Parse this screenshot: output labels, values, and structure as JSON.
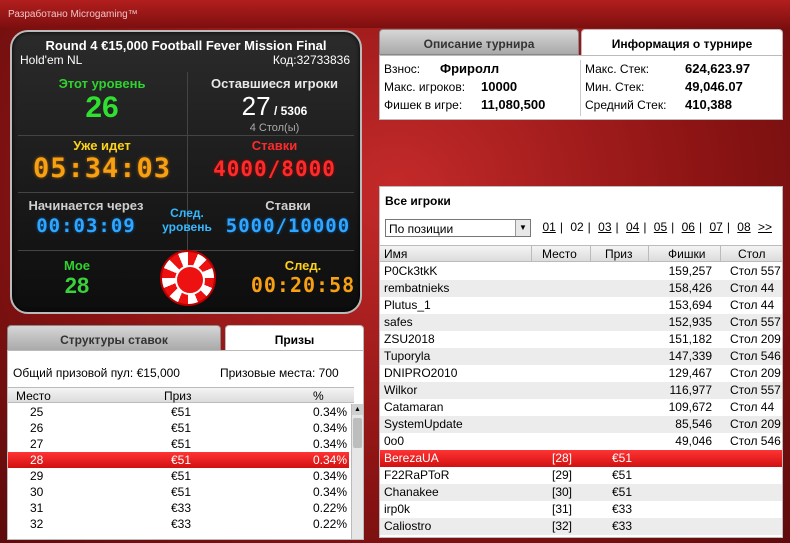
{
  "topbar": {
    "credit": "Разработано Microgaming™"
  },
  "clock": {
    "title": "Round 4 €15,000 Football Fever Mission Final",
    "game": "Hold'em NL",
    "code": "Код:32733836",
    "current_level_label": "Этот уровень",
    "current_level": "26",
    "players_left_label": "Оставшиеся игроки",
    "players_left": "27",
    "players_total": "/ 5306",
    "tables": "4 Стол(ы)",
    "elapsed_label": "Уже идет",
    "elapsed": "05:34:03",
    "stakes_label": "Ставки",
    "stakes": "4000/8000",
    "starts_in_label": "Начинается через",
    "starts_in": "00:03:09",
    "next_level_label_1": "След.",
    "next_level_label_2": "уровень",
    "next_stakes_label": "Ставки",
    "next_stakes": "5000/10000",
    "my_label": "Мое",
    "my_value": "28",
    "next_label": "След.",
    "next_time": "00:20:58"
  },
  "tabs_top": {
    "description": "Описание турнира",
    "info": "Информация о турнире"
  },
  "info": {
    "buyin_label": "Взнос:",
    "buyin": "Фриролл",
    "max_players_label": "Макс. игроков:",
    "max_players": "10000",
    "chips_label": "Фишек в игре:",
    "chips": "11,080,500",
    "max_stack_label": "Макс. Стек:",
    "max_stack": "624,623.97",
    "min_stack_label": "Мин. Стек:",
    "min_stack": "49,046.07",
    "avg_stack_label": "Средний Стек:",
    "avg_stack": "410,388"
  },
  "players": {
    "heading": "Все игроки",
    "sort_select": "По позиции",
    "pages": [
      "01",
      "02",
      "03",
      "04",
      "05",
      "06",
      "07",
      "08",
      ">>"
    ],
    "columns": {
      "name": "Имя",
      "place": "Место",
      "prize": "Приз",
      "chips": "Фишки",
      "table": "Стол"
    },
    "rows": [
      {
        "name": "P0Ck3tkK",
        "place": "",
        "prize": "",
        "chips": "159,257",
        "table": "Стол 557"
      },
      {
        "name": "rembatnieks",
        "place": "",
        "prize": "",
        "chips": "158,426",
        "table": "Стол 44"
      },
      {
        "name": "Plutus_1",
        "place": "",
        "prize": "",
        "chips": "153,694",
        "table": "Стол 44"
      },
      {
        "name": "safes",
        "place": "",
        "prize": "",
        "chips": "152,935",
        "table": "Стол 557"
      },
      {
        "name": "ZSU2018",
        "place": "",
        "prize": "",
        "chips": "151,182",
        "table": "Стол 209"
      },
      {
        "name": "Tuporyla",
        "place": "",
        "prize": "",
        "chips": "147,339",
        "table": "Стол 546"
      },
      {
        "name": "DNIPRO2010",
        "place": "",
        "prize": "",
        "chips": "129,467",
        "table": "Стол 209"
      },
      {
        "name": "Wilkor",
        "place": "",
        "prize": "",
        "chips": "116,977",
        "table": "Стол 557"
      },
      {
        "name": "Catamaran",
        "place": "",
        "prize": "",
        "chips": "109,672",
        "table": "Стол 44"
      },
      {
        "name": "SystemUpdate",
        "place": "",
        "prize": "",
        "chips": "85,546",
        "table": "Стол 209"
      },
      {
        "name": "0o0",
        "place": "",
        "prize": "",
        "chips": "49,046",
        "table": "Стол 546"
      },
      {
        "name": "BerezaUA",
        "place": "[28]",
        "prize": "€51",
        "chips": "",
        "table": ""
      },
      {
        "name": "F22RaPToR",
        "place": "[29]",
        "prize": "€51",
        "chips": "",
        "table": ""
      },
      {
        "name": "Chanakee",
        "place": "[30]",
        "prize": "€51",
        "chips": "",
        "table": ""
      },
      {
        "name": "irp0k",
        "place": "[31]",
        "prize": "€33",
        "chips": "",
        "table": ""
      },
      {
        "name": "Caliostro",
        "place": "[32]",
        "prize": "€33",
        "chips": "",
        "table": ""
      }
    ]
  },
  "tabs_bottom": {
    "structure": "Структуры ставок",
    "prizes": "Призы"
  },
  "prizes": {
    "pool": "Общий призовой пул: €15,000",
    "places": "Призовые места: 700",
    "columns": {
      "place": "Место",
      "prize": "Приз",
      "pct": "%"
    },
    "rows": [
      {
        "place": "25",
        "prize": "€51",
        "pct": "0.34%"
      },
      {
        "place": "26",
        "prize": "€51",
        "pct": "0.34%"
      },
      {
        "place": "27",
        "prize": "€51",
        "pct": "0.34%"
      },
      {
        "place": "28",
        "prize": "€51",
        "pct": "0.34%"
      },
      {
        "place": "29",
        "prize": "€51",
        "pct": "0.34%"
      },
      {
        "place": "30",
        "prize": "€51",
        "pct": "0.34%"
      },
      {
        "place": "31",
        "prize": "€33",
        "pct": "0.22%"
      },
      {
        "place": "32",
        "prize": "€33",
        "pct": "0.22%"
      }
    ]
  }
}
